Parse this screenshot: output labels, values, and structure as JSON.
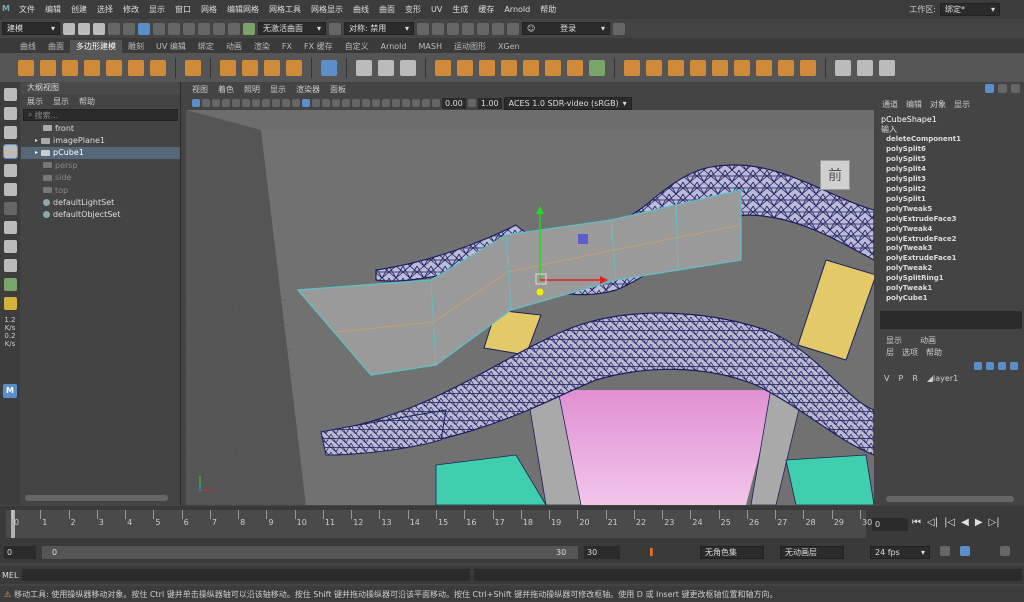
{
  "menubar": {
    "items": [
      "文件",
      "编辑",
      "创建",
      "选择",
      "修改",
      "显示",
      "窗口",
      "网格",
      "编辑网格",
      "网格工具",
      "网格显示",
      "曲线",
      "曲面",
      "变形",
      "UV",
      "生成",
      "缓存",
      "Arnold",
      "帮助"
    ],
    "workspace_label": "工作区:",
    "workspace_value": "绑定*"
  },
  "statusline": {
    "mode": "建模",
    "no_active_surface": "无激活曲面",
    "symmetry": "对称: 禁用",
    "login": "登录"
  },
  "shelf_tabs": {
    "items": [
      "曲线",
      "曲面",
      "多边形建模",
      "雕刻",
      "UV 编辑",
      "绑定",
      "动画",
      "渲染",
      "FX",
      "FX 缓存",
      "自定义",
      "Arnold",
      "MASH",
      "运动图形",
      "XGen"
    ],
    "active": "多边形建模"
  },
  "toolbox": {
    "num1": "1.2",
    "num1_unit": "K/s",
    "num2": "0.2",
    "num2_unit": "K/s",
    "m": "M"
  },
  "outliner": {
    "title": "大纲视图",
    "menus": [
      "展示",
      "显示",
      "帮助"
    ],
    "search_placeholder": "搜索...",
    "items": [
      {
        "label": "front"
      },
      {
        "label": "imagePlane1"
      },
      {
        "label": "pCube1"
      },
      {
        "label": "persp"
      },
      {
        "label": "side"
      },
      {
        "label": "top"
      },
      {
        "label": "defaultLightSet"
      },
      {
        "label": "defaultObjectSet"
      }
    ]
  },
  "viewport": {
    "menus": [
      "视图",
      "着色",
      "照明",
      "显示",
      "渲染器",
      "面板"
    ],
    "exposure": "0.00",
    "gamma": "1.00",
    "colorspace": "ACES 1.0 SDR-video (sRGB)",
    "viewcube_label": "前"
  },
  "channelbox": {
    "tabs": [
      "通道",
      "编辑",
      "对象",
      "显示"
    ],
    "shape": "pCubeShape1",
    "inputs_label": "输入",
    "history": [
      "deleteComponent1",
      "polySplit6",
      "polySplit5",
      "polySplit4",
      "polySplit3",
      "polySplit2",
      "polySplit1",
      "polyTweak5",
      "polyExtrudeFace3",
      "polyTweak4",
      "polyExtrudeFace2",
      "polyTweak3",
      "polyExtrudeFace1",
      "polyTweak2",
      "polySplitRing1",
      "polyTweak1",
      "polyCube1"
    ]
  },
  "layers": {
    "tabs": [
      "显示",
      "动画"
    ],
    "menus": [
      "层",
      "选项",
      "帮助"
    ],
    "layer": {
      "v": "V",
      "p": "P",
      "r": "R",
      "name": "layer1"
    }
  },
  "timeline": {
    "ticks": [
      "0",
      "1",
      "2",
      "3",
      "4",
      "5",
      "6",
      "7",
      "8",
      "9",
      "10",
      "11",
      "12",
      "13",
      "14",
      "15",
      "16",
      "17",
      "18",
      "19",
      "20",
      "21",
      "22",
      "23",
      "24",
      "25",
      "26",
      "27",
      "28",
      "29",
      "30"
    ],
    "current_frame": "0"
  },
  "rangebar": {
    "start": "0",
    "inner_start": "0",
    "inner_end": "30",
    "end": "30",
    "character_set": "无角色集",
    "anim_layer": "无动画层",
    "fps": "24 fps"
  },
  "mel": {
    "label": "MEL"
  },
  "helpline": {
    "text": "移动工具: 使用操纵器移动对象。按住 Ctrl 键并单击操纵器轴可以沿该轴移动。按住 Shift 键并拖动操纵器可沿该平面移动。按住 Ctrl+Shift 键并拖动操纵器可修改枢轴。使用 D 或 Insert 键更改枢轴位置和轴方向。"
  },
  "colors": {
    "selection": "#56677a",
    "accent": "#5b8fc9",
    "wire_navy": "#1c1f5e",
    "mesh_grey": "#999999",
    "mesh_pink": "#d27bc6",
    "mesh_teal": "#3fcfae",
    "mesh_yellow": "#e4c968"
  }
}
